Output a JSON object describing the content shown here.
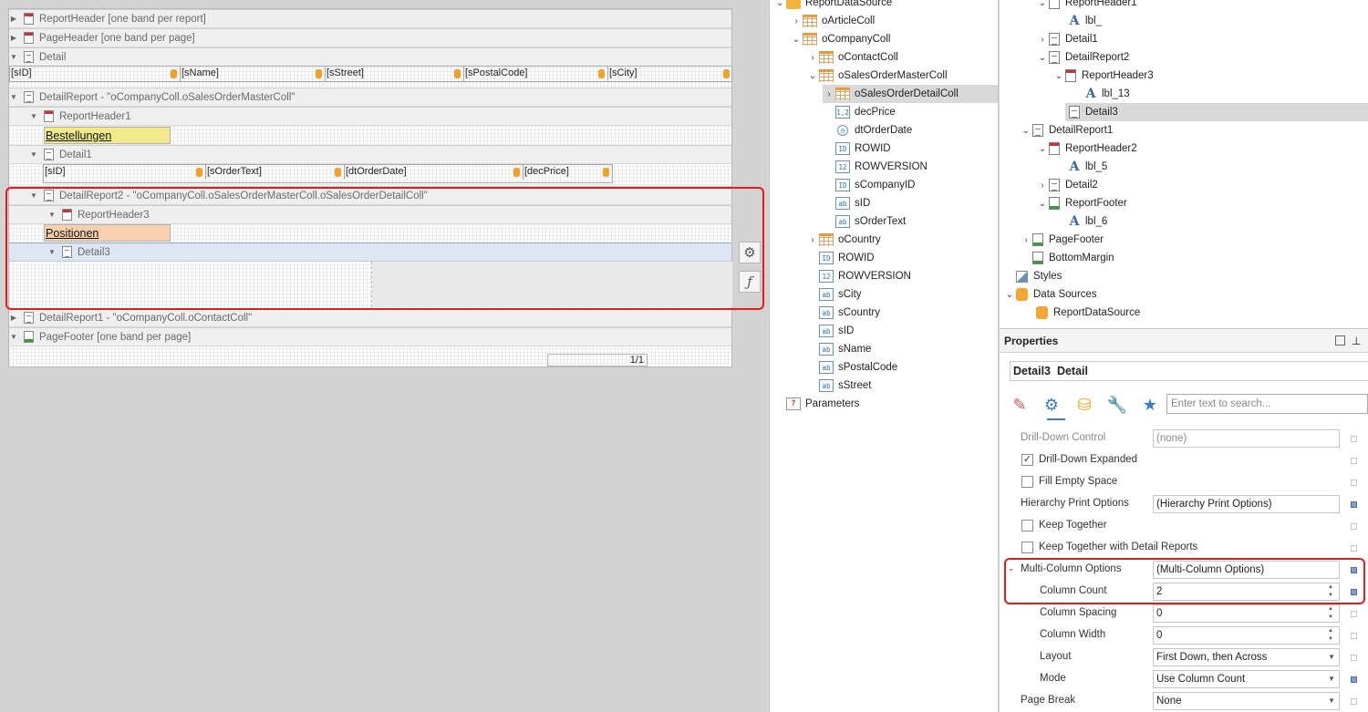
{
  "designer": {
    "bands": {
      "report_header": "ReportHeader [one band per report]",
      "page_header": "PageHeader [one band per page]",
      "detail": "Detail",
      "detail_report": "DetailReport - \"oCompanyColl.oSalesOrderMasterColl\"",
      "report_header1": "ReportHeader1",
      "detail1": "Detail1",
      "detail_report2": "DetailReport2 - \"oCompanyColl.oSalesOrderMasterColl.oSalesOrderDetailColl\"",
      "report_header3": "ReportHeader3",
      "detail3": "Detail3",
      "detail_report1": "DetailReport1 - \"oCompanyColl.oContactColl\"",
      "page_footer": "PageFooter [one band per page]"
    },
    "detail_fields": [
      "[sID]",
      "[sName]",
      "[sStreet]",
      "[sPostalCode]",
      "[sCity]"
    ],
    "detail1_fields": [
      "[sID]",
      "[sOrderText]",
      "[dtOrderDate]",
      "[decPrice]"
    ],
    "label_bestellungen": "Bestellungen",
    "label_positionen": "Positionen",
    "page_number": "1/1",
    "side_buttons": {
      "settings_icon": "gear-icon",
      "function_glyph": "ƒ"
    },
    "colors": {
      "highlight": "#e21c1c",
      "label_yellow": "#f2e98c",
      "label_orange": "#f9d0b0"
    }
  },
  "field_list": {
    "items": [
      {
        "label": "ReportDataSource",
        "icon": "folder-icon",
        "chevron": "⌄"
      },
      {
        "label": "oArticleColl",
        "icon": "table-icon",
        "chevron": "›"
      },
      {
        "label": "oCompanyColl",
        "icon": "table-icon",
        "chevron": "⌄"
      },
      {
        "label": "oContactColl",
        "icon": "table-icon",
        "chevron": "›"
      },
      {
        "label": "oSalesOrderMasterColl",
        "icon": "table-icon",
        "chevron": "⌄"
      },
      {
        "label": "oSalesOrderDetailColl",
        "icon": "table-icon",
        "chevron": "›"
      },
      {
        "label": "decPrice",
        "icon": "1,2",
        "chevron": ""
      },
      {
        "label": "dtOrderDate",
        "icon": "clock-icon",
        "chevron": ""
      },
      {
        "label": "ROWID",
        "icon": "ID",
        "chevron": ""
      },
      {
        "label": "ROWVERSION",
        "icon": "12",
        "chevron": ""
      },
      {
        "label": "sCompanyID",
        "icon": "ID",
        "chevron": ""
      },
      {
        "label": "sID",
        "icon": "ab",
        "chevron": ""
      },
      {
        "label": "sOrderText",
        "icon": "ab",
        "chevron": ""
      },
      {
        "label": "oCountry",
        "icon": "table-icon",
        "chevron": "›"
      },
      {
        "label": "ROWID",
        "icon": "ID",
        "chevron": ""
      },
      {
        "label": "ROWVERSION",
        "icon": "12",
        "chevron": ""
      },
      {
        "label": "sCity",
        "icon": "ab",
        "chevron": ""
      },
      {
        "label": "sCountry",
        "icon": "ab",
        "chevron": ""
      },
      {
        "label": "sID",
        "icon": "ab",
        "chevron": ""
      },
      {
        "label": "sName",
        "icon": "ab",
        "chevron": ""
      },
      {
        "label": "sPostalCode",
        "icon": "ab",
        "chevron": ""
      },
      {
        "label": "sStreet",
        "icon": "ab",
        "chevron": ""
      },
      {
        "label": "Parameters",
        "icon": "?",
        "chevron": ""
      }
    ]
  },
  "explorer": {
    "items": [
      {
        "label": "ReportHeader1",
        "chevron": "⌄"
      },
      {
        "label": "lbl_",
        "chevron": ""
      },
      {
        "label": "Detail1",
        "chevron": "›"
      },
      {
        "label": "DetailReport2",
        "chevron": "⌄"
      },
      {
        "label": "ReportHeader3",
        "chevron": "⌄"
      },
      {
        "label": "lbl_13",
        "chevron": ""
      },
      {
        "label": "Detail3",
        "chevron": ""
      },
      {
        "label": "DetailReport1",
        "chevron": "⌄"
      },
      {
        "label": "ReportHeader2",
        "chevron": "⌄"
      },
      {
        "label": "lbl_5",
        "chevron": ""
      },
      {
        "label": "Detail2",
        "chevron": "›"
      },
      {
        "label": "ReportFooter",
        "chevron": "⌄"
      },
      {
        "label": "lbl_6",
        "chevron": ""
      },
      {
        "label": "PageFooter",
        "chevron": "›"
      },
      {
        "label": "BottomMargin",
        "chevron": ""
      },
      {
        "label": "Styles",
        "chevron": ""
      },
      {
        "label": "Data Sources",
        "chevron": "⌄"
      },
      {
        "label": "ReportDataSource",
        "chevron": ""
      }
    ]
  },
  "properties": {
    "title": "Properties",
    "selector_name": "Detail3",
    "selector_type": "Detail",
    "search_placeholder": "Enter text to search...",
    "tabs": [
      "brush-icon",
      "gears-icon",
      "database-icon",
      "wrench-icon",
      "star-icon"
    ],
    "rows": [
      {
        "name": "Drill-Down Control",
        "value": "(none)",
        "disabled": true
      },
      {
        "name": "Drill-Down Expanded",
        "checked": true
      },
      {
        "name": "Fill Empty Space",
        "checked": false
      },
      {
        "name": "Hierarchy Print Options",
        "value": "(Hierarchy Print Options)"
      },
      {
        "name": "Keep Together",
        "checked": false
      },
      {
        "name": "Keep Together with Detail Reports",
        "checked": false
      },
      {
        "name": "Multi-Column Options",
        "value": "(Multi-Column Options)"
      },
      {
        "name": "Column Count",
        "value": "2"
      },
      {
        "name": "Column Spacing",
        "value": "0"
      },
      {
        "name": "Column Width",
        "value": "0"
      },
      {
        "name": "Layout",
        "value": "First Down, then Across"
      },
      {
        "name": "Mode",
        "value": "Use Column Count"
      },
      {
        "name": "Page Break",
        "value": "None"
      }
    ]
  }
}
